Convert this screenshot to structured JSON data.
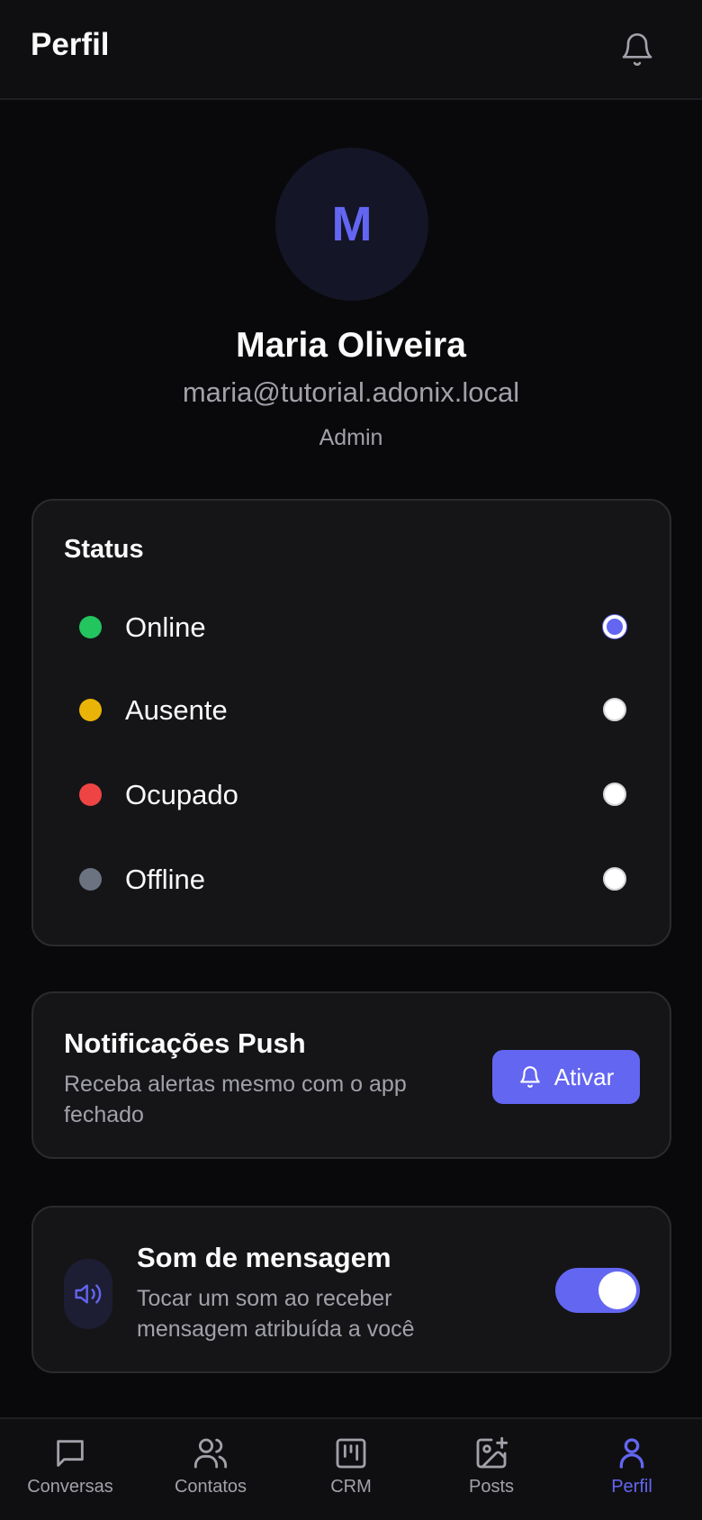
{
  "header": {
    "title": "Perfil",
    "icon": "bell-icon"
  },
  "profile": {
    "initial": "M",
    "name": "Maria Oliveira",
    "email": "maria@tutorial.adonix.local",
    "role": "Admin"
  },
  "status": {
    "title": "Status",
    "selected": "Online",
    "options": [
      {
        "label": "Online",
        "color": "#22c55e",
        "checked": true
      },
      {
        "label": "Ausente",
        "color": "#eab308",
        "checked": false
      },
      {
        "label": "Ocupado",
        "color": "#ef4444",
        "checked": false
      },
      {
        "label": "Offline",
        "color": "#6b7280",
        "checked": false
      }
    ]
  },
  "push": {
    "title": "Notificações Push",
    "description": "Receba alertas mesmo com o app fechado",
    "button_label": "Ativar",
    "button_icon": "bell-icon"
  },
  "sound": {
    "title": "Som de mensagem",
    "description": "Tocar um som ao receber mensagem atribuída a você",
    "icon": "speaker-icon",
    "enabled": true
  },
  "nav": {
    "items": [
      {
        "label": "Conversas",
        "icon": "chat-icon",
        "active": false
      },
      {
        "label": "Contatos",
        "icon": "users-icon",
        "active": false
      },
      {
        "label": "CRM",
        "icon": "kanban-icon",
        "active": false
      },
      {
        "label": "Posts",
        "icon": "image-plus-icon",
        "active": false
      },
      {
        "label": "Perfil",
        "icon": "user-icon",
        "active": true
      }
    ]
  },
  "colors": {
    "accent": "#6366f1",
    "background": "#09090b",
    "card": "#151518",
    "muted_text": "#a1a1aa"
  }
}
